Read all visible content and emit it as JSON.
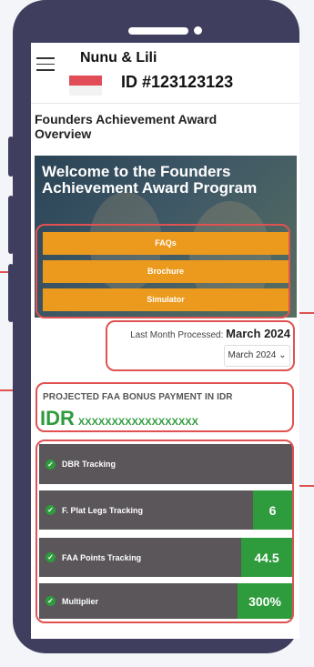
{
  "header": {
    "menu_icon": "hamburger-icon",
    "account_name": "Nunu & Lili",
    "flag_icon": "indonesia-flag-icon",
    "account_id": "ID #123123123"
  },
  "page_title": "Founders Achievement Award Overview",
  "banner": {
    "title": "Welcome to the Founders Achievement Award Program",
    "buttons": [
      "FAQs",
      "Brochure",
      "Simulator"
    ]
  },
  "processed": {
    "label": "Last Month Processed: ",
    "value": "March 2024"
  },
  "month_select": {
    "value": "March 2024",
    "icon": "chevron-down-icon"
  },
  "projected": {
    "label": "PROJECTED FAA BONUS PAYMENT IN IDR",
    "currency": "IDR",
    "amount": "XXXXXXXXXXXXXXXXXX"
  },
  "tracking": [
    {
      "label": "DBR Tracking",
      "value": ""
    },
    {
      "label": "F. Plat Legs Tracking",
      "value": "6"
    },
    {
      "label": "FAA Points Tracking",
      "value": "44.5"
    },
    {
      "label": "Multiplier",
      "value": "300%"
    }
  ],
  "colors": {
    "frame": "#3f3e5e",
    "accent_orange": "#ec9a1e",
    "accent_green": "#2e9b3d",
    "highlight_red": "#e05252"
  }
}
